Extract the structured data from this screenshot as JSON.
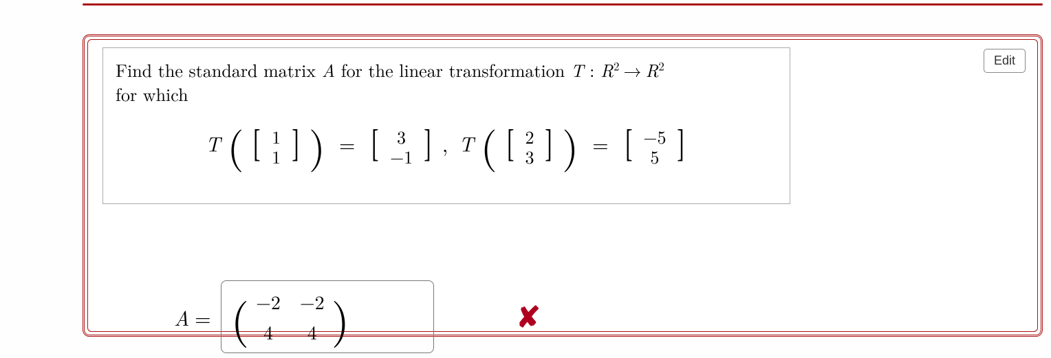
{
  "edit_button_label": "Edit",
  "question": {
    "prompt_pre": "Find the standard matrix ",
    "matrix_var": "A",
    "prompt_mid": " for the linear transformation ",
    "map_var": "T",
    "colon": " : ",
    "domain_base": "R",
    "domain_exp": "2",
    "arrow": "→",
    "codomain_base": "R",
    "codomain_exp": "2",
    "prompt_tail": "for which"
  },
  "equations": {
    "T": "T",
    "eq": "=",
    "comma": ",",
    "v1": {
      "top": "1",
      "bot": "1"
    },
    "r1": {
      "top": "3",
      "bot": "−1"
    },
    "v2": {
      "top": "2",
      "bot": "3"
    },
    "r2": {
      "top": "−5",
      "bot": "5"
    }
  },
  "answer": {
    "label_var": "A",
    "eq": "=",
    "m": {
      "a": "−2",
      "b": "−2",
      "c": "4",
      "d": "4"
    },
    "mark": "✘"
  }
}
